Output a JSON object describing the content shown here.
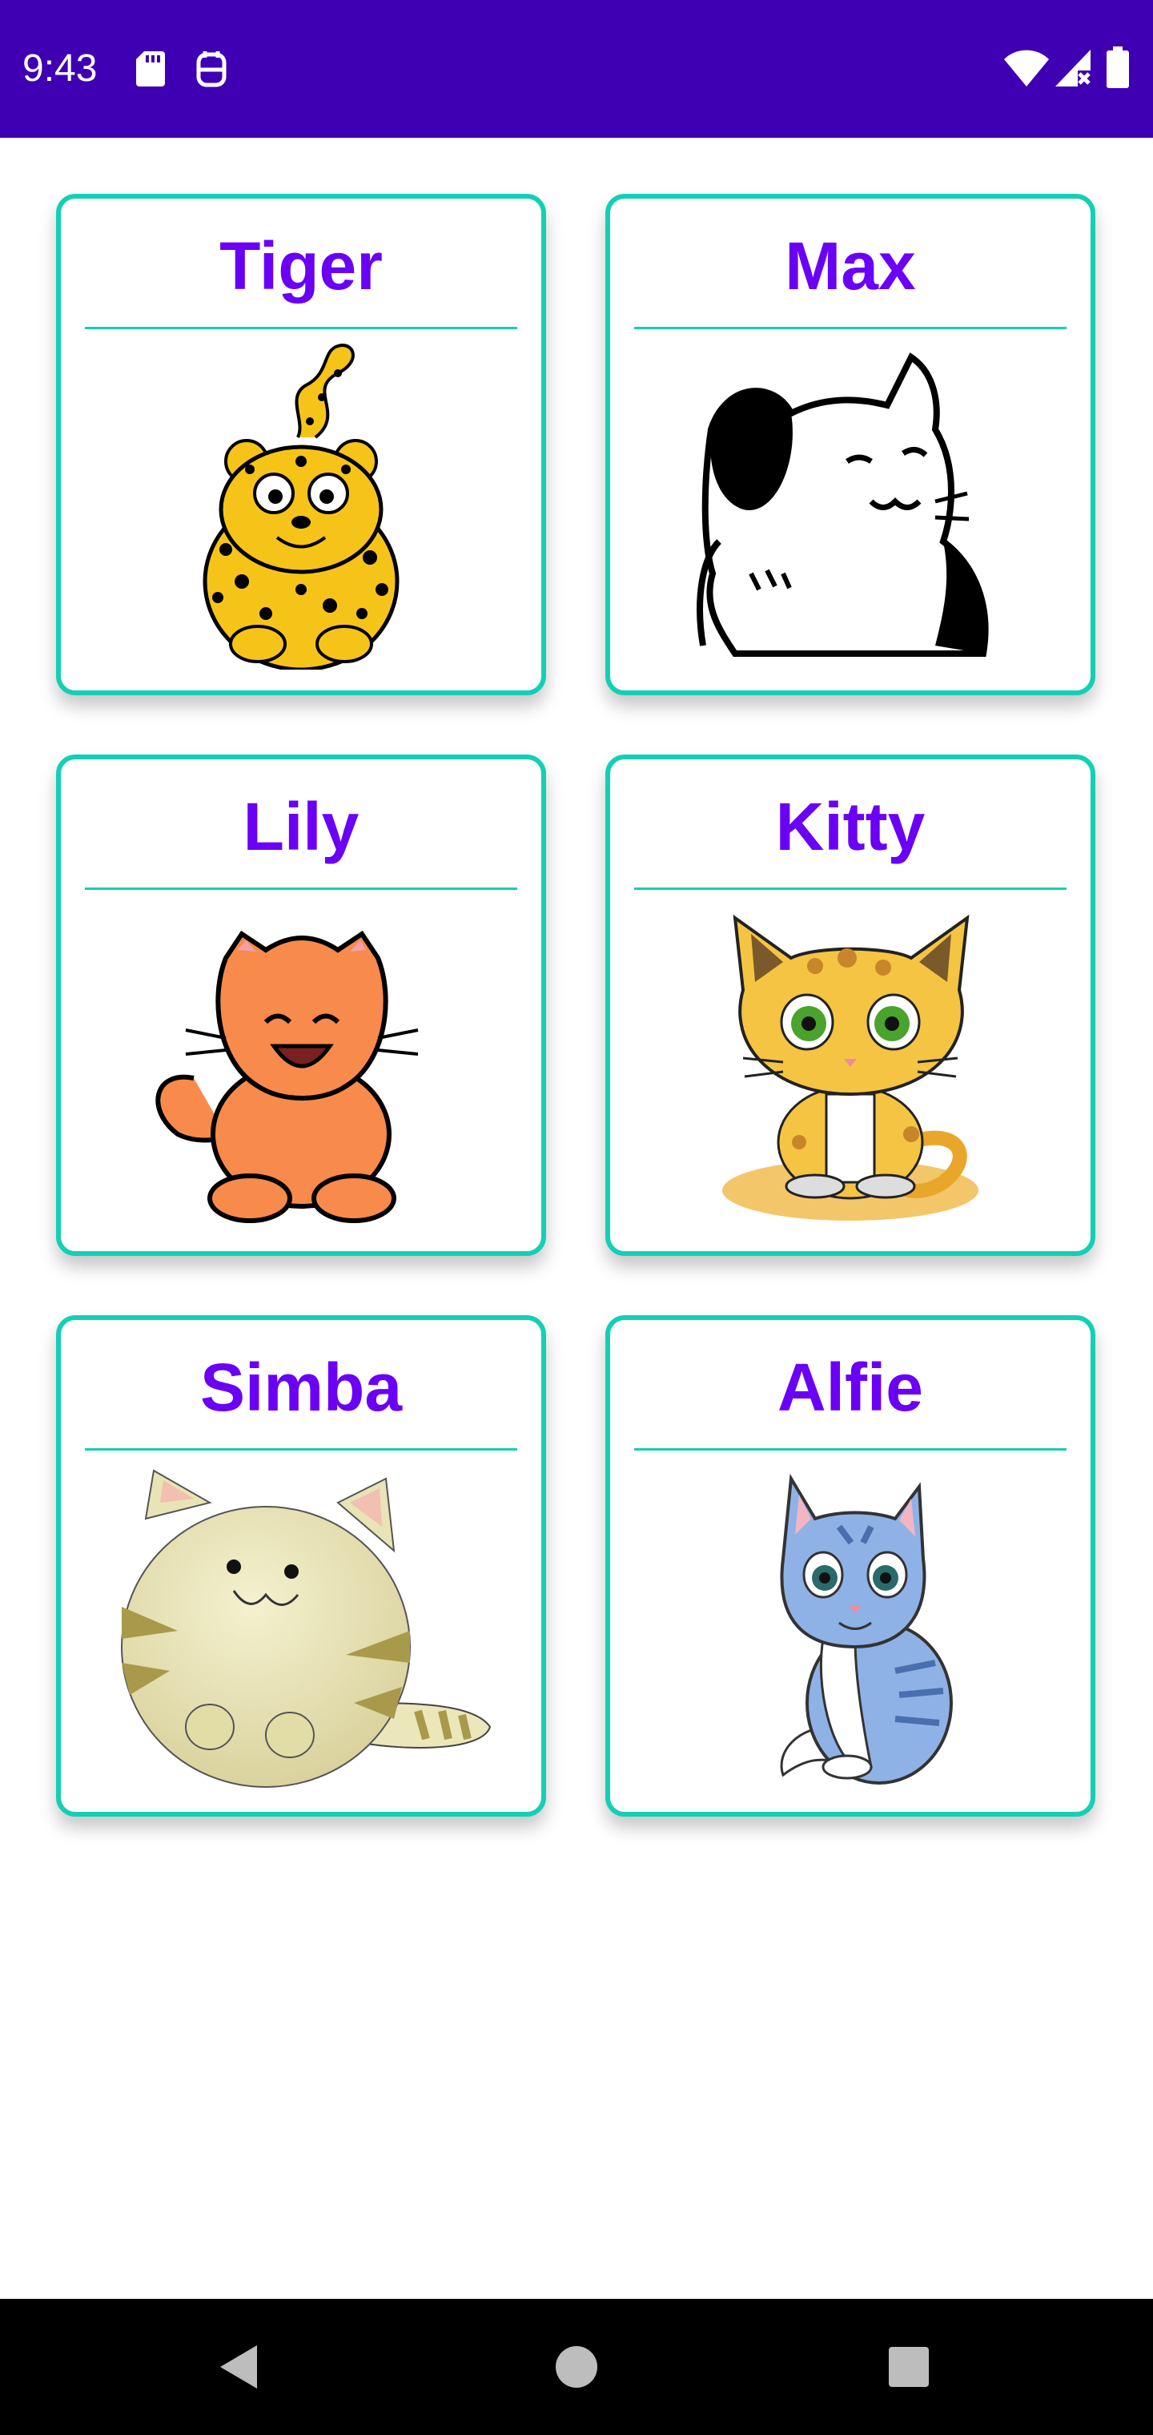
{
  "status_bar": {
    "time": "9:43",
    "icons": [
      "sd-card-icon",
      "sim-card-icon",
      "wifi-icon",
      "signal-icon",
      "battery-icon"
    ]
  },
  "cards": [
    {
      "title": "Tiger",
      "image": "leopard-cartoon"
    },
    {
      "title": "Max",
      "image": "waving-cat-line-art"
    },
    {
      "title": "Lily",
      "image": "orange-kitten"
    },
    {
      "title": "Kitty",
      "image": "spotted-kitten-sitting"
    },
    {
      "title": "Simba",
      "image": "round-tabby-cat"
    },
    {
      "title": "Alfie",
      "image": "blue-striped-kitten"
    }
  ],
  "nav_bar": {
    "buttons": [
      "back-icon",
      "home-icon",
      "recents-icon"
    ]
  },
  "colors": {
    "status_bar_bg": "#3f00b3",
    "card_border": "#13d0b4",
    "title_text": "#6a00f4",
    "nav_bar_bg": "#000000"
  }
}
